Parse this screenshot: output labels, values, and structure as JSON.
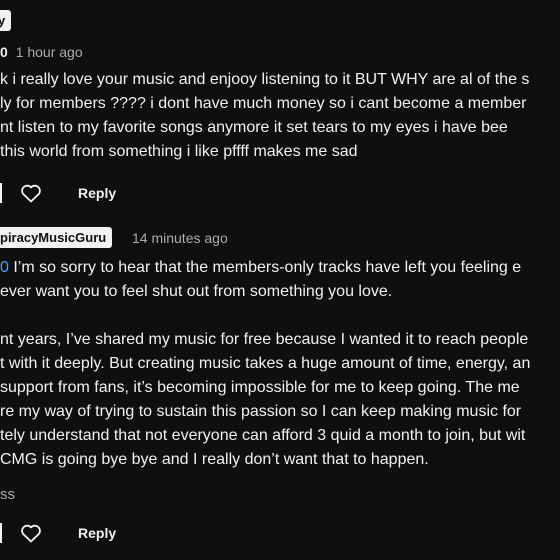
{
  "comment1": {
    "author_chip": "y",
    "mention_fragment": "0",
    "time": "1 hour ago",
    "lines": [
      "k i really love your music and enjooy listening to it   BUT WHY are al of the s",
      "ly for members ????  i dont have much money so i cant become a member",
      "nt listen to my favorite songs anymore  it set tears to my eyes     i have bee",
      " this world from something i like   pffff  makes me sad"
    ],
    "reply_label": "Reply"
  },
  "comment2": {
    "author_chip": "piracyMusicGuru",
    "time": "14 minutes ago",
    "mention_fragment": "0",
    "lines": [
      " I’m so sorry to hear that the members-only tracks have left you feeling e",
      "ever want you to feel shut out from something you love.",
      "",
      "nt years, I’ve shared my music for free because I wanted it to reach people",
      "t with it deeply. But creating music takes a huge amount of time, energy, an",
      "support from fans, it’s becoming impossible for me to keep going. The me",
      "re my way of trying to sustain this passion so I can keep making music for",
      "tely understand that not everyone can afford 3 quid a month to join, but wit",
      " CMG is going bye bye and I really don’t want that to happen."
    ],
    "show_less": "ss",
    "reply_label": "Reply"
  },
  "icons": {
    "like": "heart-outline-icon"
  }
}
